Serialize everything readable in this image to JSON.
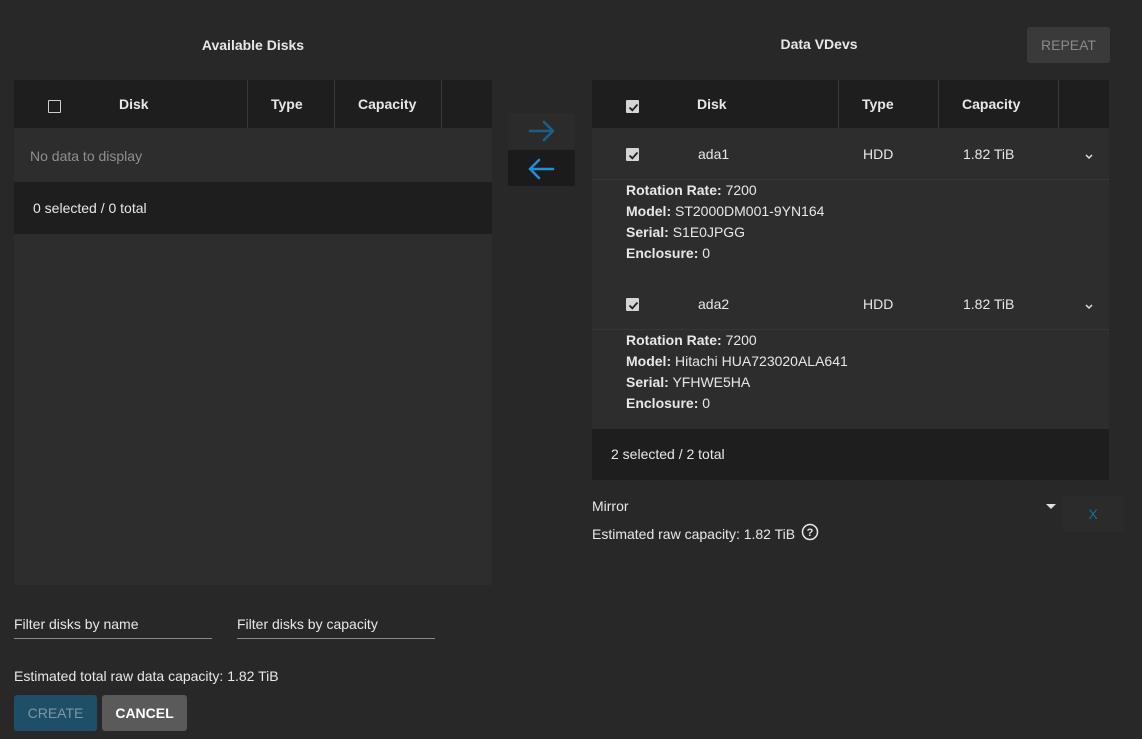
{
  "available": {
    "title": "Available Disks",
    "columns": [
      "Disk",
      "Type",
      "Capacity"
    ],
    "empty_text": "No data to display",
    "footer": "0 selected / 0 total"
  },
  "vdevs": {
    "title": "Data VDevs",
    "repeat_label": "REPEAT",
    "columns": [
      "Disk",
      "Type",
      "Capacity"
    ],
    "rows": [
      {
        "disk": "ada1",
        "type": "HDD",
        "capacity": "1.82 TiB",
        "details": [
          {
            "label": "Rotation Rate:",
            "value": "7200"
          },
          {
            "label": "Model:",
            "value": "ST2000DM001-9YN164"
          },
          {
            "label": "Serial:",
            "value": "S1E0JPGG"
          },
          {
            "label": "Enclosure:",
            "value": "0"
          }
        ]
      },
      {
        "disk": "ada2",
        "type": "HDD",
        "capacity": "1.82 TiB",
        "details": [
          {
            "label": "Rotation Rate:",
            "value": "7200"
          },
          {
            "label": "Model:",
            "value": "Hitachi HUA723020ALA641"
          },
          {
            "label": "Serial:",
            "value": "YFHWE5HA"
          },
          {
            "label": "Enclosure:",
            "value": "0"
          }
        ]
      }
    ],
    "footer": "2 selected / 2 total",
    "layout_select": "Mirror",
    "estimated_raw": "Estimated raw capacity: 1.82 TiB",
    "remove_label": "X"
  },
  "filters": {
    "name_placeholder": "Filter disks by name",
    "capacity_placeholder": "Filter disks by capacity"
  },
  "total_capacity": "Estimated total raw data capacity: 1.82 TiB",
  "actions": {
    "create": "CREATE",
    "cancel": "CANCEL"
  },
  "colors": {
    "accent": "#1f8fd6",
    "create_bg": "#1f4e68",
    "cancel_bg": "#5a5a5a"
  }
}
